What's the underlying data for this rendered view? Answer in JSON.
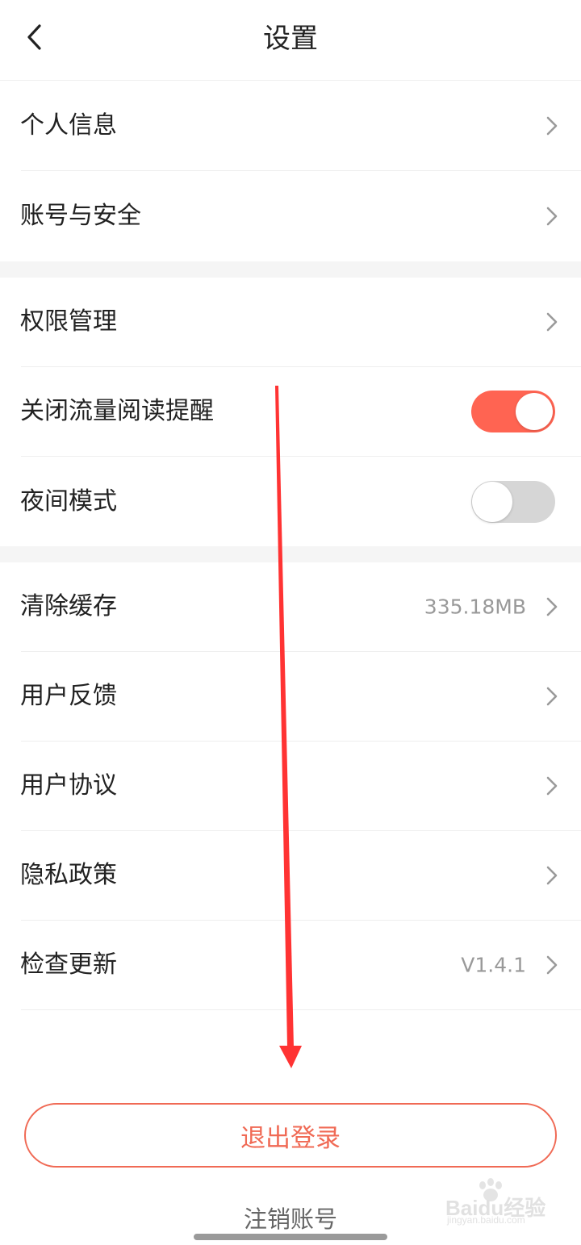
{
  "header": {
    "title": "设置",
    "back_icon": "chevron-left-icon"
  },
  "sections": [
    {
      "rows": [
        {
          "label": "个人信息",
          "type": "link"
        },
        {
          "label": "账号与安全",
          "type": "link"
        }
      ]
    },
    {
      "rows": [
        {
          "label": "权限管理",
          "type": "link"
        },
        {
          "label": "关闭流量阅读提醒",
          "type": "toggle",
          "on": true
        },
        {
          "label": "夜间模式",
          "type": "toggle",
          "on": false
        }
      ]
    },
    {
      "rows": [
        {
          "label": "清除缓存",
          "type": "link",
          "value": "335.18MB"
        },
        {
          "label": "用户反馈",
          "type": "link"
        },
        {
          "label": "用户协议",
          "type": "link"
        },
        {
          "label": "隐私政策",
          "type": "link"
        },
        {
          "label": "检查更新",
          "type": "link",
          "value": "V1.4.1"
        }
      ]
    }
  ],
  "footer": {
    "logout_label": "退出登录",
    "cancel_account_label": "注销账号"
  },
  "watermark": {
    "brand": "Baidu经验",
    "url": "jingyan.baidu.com"
  },
  "colors": {
    "accent": "#f06a55",
    "toggle_on": "#ff6452",
    "toggle_off": "#d6d6d6",
    "annotation_arrow": "#ff3333"
  }
}
